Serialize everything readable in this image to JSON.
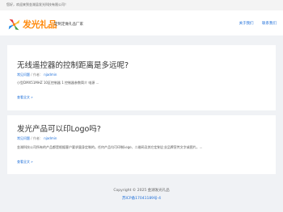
{
  "topbar": {
    "text": "您好，欢迎来到金湖县发光科技有限公司！"
  },
  "header": {
    "logo_text": "发光礼品",
    "tagline": "定制定做礼品厂家",
    "nav": [
      "关于我们",
      "联系我们"
    ]
  },
  "posts": [
    {
      "title": "无线遥控器的控制距离是多远呢?",
      "category": "常见问题",
      "author_label": "作者：",
      "author": "njadmin",
      "excerpt": "小型DMX51MHZ 10区控制器 1 控制器参数简介    电源 ...",
      "readmore": "查看全文 »"
    },
    {
      "title": "发光产品可以印Logo吗?",
      "category": "常见问题",
      "author_label": "作者：",
      "author": "njadmin",
      "excerpt": "金湖科技公司所有的产品都是根据客户要求量身定制的。任何产品均可印制Logo、二维码及其它定制企业品牌宣传文字或图片。...",
      "readmore": "查看全文 »"
    }
  ],
  "footer": {
    "copyright": "Copyright © 2025 金湖发光礼品",
    "icp": "苏ICP备17041189号-4"
  },
  "colors": {
    "accent": "#1e6fd9",
    "brand": "#ff8a0d",
    "background": "#f0f2f5"
  }
}
